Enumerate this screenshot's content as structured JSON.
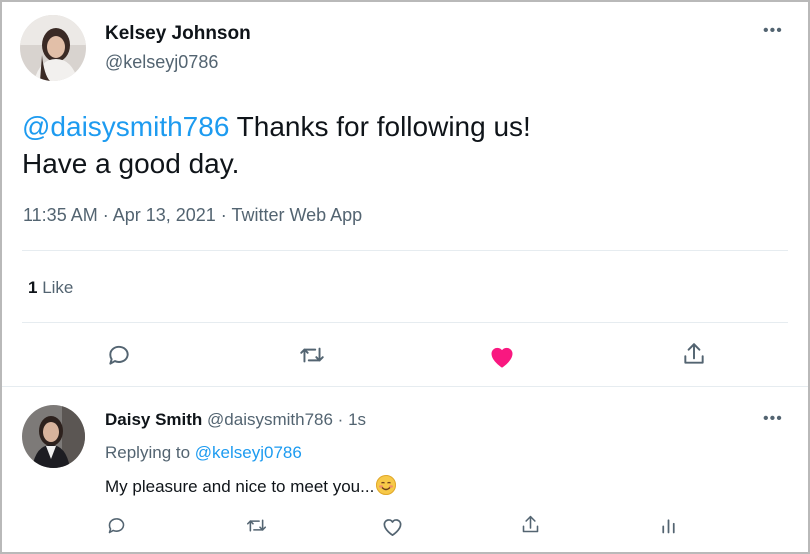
{
  "tweet": {
    "author_name": "Kelsey Johnson",
    "author_handle": "@kelseyj0786",
    "mention": "@daisysmith786",
    "text_line1": " Thanks for following us!",
    "text_line2": "Have a good day.",
    "meta": "11:35 AM · Apr 13, 2021 · Twitter Web App",
    "like_count": "1",
    "like_label": " Like",
    "liked": true,
    "more_icon": "more-horizontal-icon"
  },
  "actions": {
    "reply_icon": "reply-icon",
    "retweet_icon": "retweet-icon",
    "like_icon": "heart-filled-icon",
    "share_icon": "share-icon"
  },
  "reply": {
    "author_name": "Daisy Smith",
    "author_meta": " @daisysmith786 · 1s",
    "replying_to_label": "Replying to ",
    "replying_to_handle": "@kelseyj0786",
    "text": "My pleasure and nice to meet you...",
    "emoji_icon": "smiling-face-emoji",
    "actions": [
      "reply-icon",
      "retweet-icon",
      "heart-outline-icon",
      "share-icon",
      "analytics-icon"
    ]
  },
  "colors": {
    "accent": "#1d9bf0",
    "like": "#f91880",
    "muted": "#536471",
    "text": "#0f1419"
  }
}
